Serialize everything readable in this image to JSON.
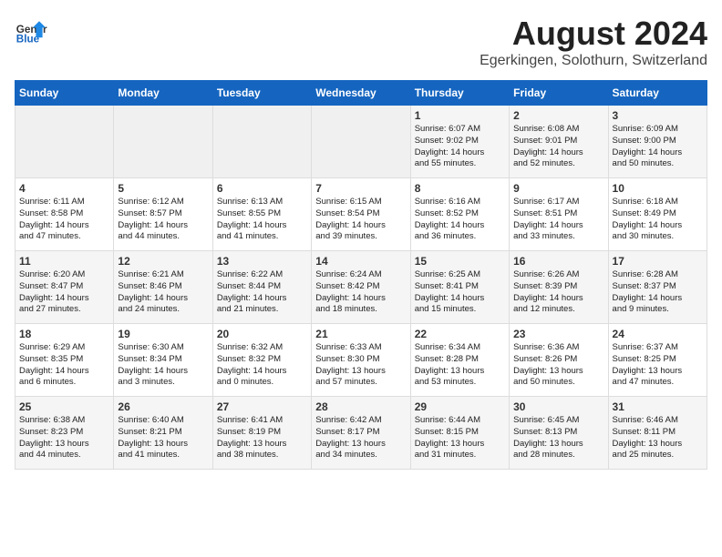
{
  "header": {
    "logo_general": "General",
    "logo_blue": "Blue",
    "month_title": "August 2024",
    "location": "Egerkingen, Solothurn, Switzerland"
  },
  "days_of_week": [
    "Sunday",
    "Monday",
    "Tuesday",
    "Wednesday",
    "Thursday",
    "Friday",
    "Saturday"
  ],
  "weeks": [
    [
      {
        "day": "",
        "info": ""
      },
      {
        "day": "",
        "info": ""
      },
      {
        "day": "",
        "info": ""
      },
      {
        "day": "",
        "info": ""
      },
      {
        "day": "1",
        "info": "Sunrise: 6:07 AM\nSunset: 9:02 PM\nDaylight: 14 hours\nand 55 minutes."
      },
      {
        "day": "2",
        "info": "Sunrise: 6:08 AM\nSunset: 9:01 PM\nDaylight: 14 hours\nand 52 minutes."
      },
      {
        "day": "3",
        "info": "Sunrise: 6:09 AM\nSunset: 9:00 PM\nDaylight: 14 hours\nand 50 minutes."
      }
    ],
    [
      {
        "day": "4",
        "info": "Sunrise: 6:11 AM\nSunset: 8:58 PM\nDaylight: 14 hours\nand 47 minutes."
      },
      {
        "day": "5",
        "info": "Sunrise: 6:12 AM\nSunset: 8:57 PM\nDaylight: 14 hours\nand 44 minutes."
      },
      {
        "day": "6",
        "info": "Sunrise: 6:13 AM\nSunset: 8:55 PM\nDaylight: 14 hours\nand 41 minutes."
      },
      {
        "day": "7",
        "info": "Sunrise: 6:15 AM\nSunset: 8:54 PM\nDaylight: 14 hours\nand 39 minutes."
      },
      {
        "day": "8",
        "info": "Sunrise: 6:16 AM\nSunset: 8:52 PM\nDaylight: 14 hours\nand 36 minutes."
      },
      {
        "day": "9",
        "info": "Sunrise: 6:17 AM\nSunset: 8:51 PM\nDaylight: 14 hours\nand 33 minutes."
      },
      {
        "day": "10",
        "info": "Sunrise: 6:18 AM\nSunset: 8:49 PM\nDaylight: 14 hours\nand 30 minutes."
      }
    ],
    [
      {
        "day": "11",
        "info": "Sunrise: 6:20 AM\nSunset: 8:47 PM\nDaylight: 14 hours\nand 27 minutes."
      },
      {
        "day": "12",
        "info": "Sunrise: 6:21 AM\nSunset: 8:46 PM\nDaylight: 14 hours\nand 24 minutes."
      },
      {
        "day": "13",
        "info": "Sunrise: 6:22 AM\nSunset: 8:44 PM\nDaylight: 14 hours\nand 21 minutes."
      },
      {
        "day": "14",
        "info": "Sunrise: 6:24 AM\nSunset: 8:42 PM\nDaylight: 14 hours\nand 18 minutes."
      },
      {
        "day": "15",
        "info": "Sunrise: 6:25 AM\nSunset: 8:41 PM\nDaylight: 14 hours\nand 15 minutes."
      },
      {
        "day": "16",
        "info": "Sunrise: 6:26 AM\nSunset: 8:39 PM\nDaylight: 14 hours\nand 12 minutes."
      },
      {
        "day": "17",
        "info": "Sunrise: 6:28 AM\nSunset: 8:37 PM\nDaylight: 14 hours\nand 9 minutes."
      }
    ],
    [
      {
        "day": "18",
        "info": "Sunrise: 6:29 AM\nSunset: 8:35 PM\nDaylight: 14 hours\nand 6 minutes."
      },
      {
        "day": "19",
        "info": "Sunrise: 6:30 AM\nSunset: 8:34 PM\nDaylight: 14 hours\nand 3 minutes."
      },
      {
        "day": "20",
        "info": "Sunrise: 6:32 AM\nSunset: 8:32 PM\nDaylight: 14 hours\nand 0 minutes."
      },
      {
        "day": "21",
        "info": "Sunrise: 6:33 AM\nSunset: 8:30 PM\nDaylight: 13 hours\nand 57 minutes."
      },
      {
        "day": "22",
        "info": "Sunrise: 6:34 AM\nSunset: 8:28 PM\nDaylight: 13 hours\nand 53 minutes."
      },
      {
        "day": "23",
        "info": "Sunrise: 6:36 AM\nSunset: 8:26 PM\nDaylight: 13 hours\nand 50 minutes."
      },
      {
        "day": "24",
        "info": "Sunrise: 6:37 AM\nSunset: 8:25 PM\nDaylight: 13 hours\nand 47 minutes."
      }
    ],
    [
      {
        "day": "25",
        "info": "Sunrise: 6:38 AM\nSunset: 8:23 PM\nDaylight: 13 hours\nand 44 minutes."
      },
      {
        "day": "26",
        "info": "Sunrise: 6:40 AM\nSunset: 8:21 PM\nDaylight: 13 hours\nand 41 minutes."
      },
      {
        "day": "27",
        "info": "Sunrise: 6:41 AM\nSunset: 8:19 PM\nDaylight: 13 hours\nand 38 minutes."
      },
      {
        "day": "28",
        "info": "Sunrise: 6:42 AM\nSunset: 8:17 PM\nDaylight: 13 hours\nand 34 minutes."
      },
      {
        "day": "29",
        "info": "Sunrise: 6:44 AM\nSunset: 8:15 PM\nDaylight: 13 hours\nand 31 minutes."
      },
      {
        "day": "30",
        "info": "Sunrise: 6:45 AM\nSunset: 8:13 PM\nDaylight: 13 hours\nand 28 minutes."
      },
      {
        "day": "31",
        "info": "Sunrise: 6:46 AM\nSunset: 8:11 PM\nDaylight: 13 hours\nand 25 minutes."
      }
    ]
  ]
}
